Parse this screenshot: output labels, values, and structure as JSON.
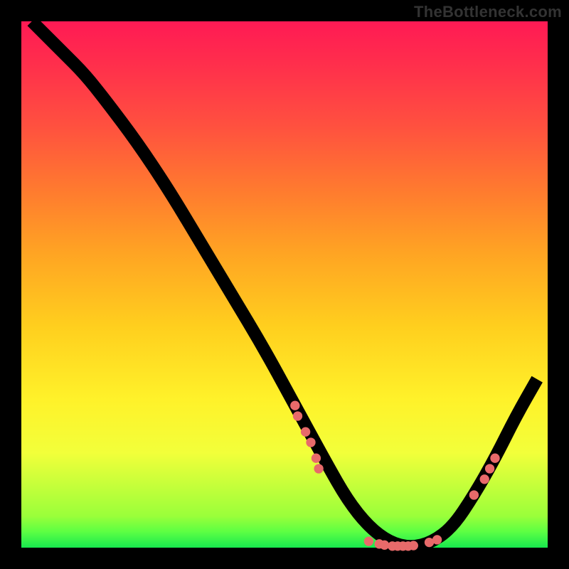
{
  "watermark": "TheBottleneck.com",
  "chart_data": {
    "type": "line",
    "title": "",
    "xlabel": "",
    "ylabel": "",
    "xlim": [
      0,
      100
    ],
    "ylim": [
      0,
      100
    ],
    "background": {
      "type": "vertical-gradient",
      "stops": [
        {
          "pos": 0,
          "color": "#ff1a54"
        },
        {
          "pos": 20,
          "color": "#ff513f"
        },
        {
          "pos": 44,
          "color": "#ffa423"
        },
        {
          "pos": 72,
          "color": "#fff22a"
        },
        {
          "pos": 100,
          "color": "#17e84e"
        }
      ]
    },
    "series": [
      {
        "name": "bottleneck-curve",
        "color": "#000000",
        "x": [
          2,
          5,
          8,
          12,
          16,
          22,
          28,
          34,
          40,
          46,
          52,
          58,
          62,
          66,
          70,
          74,
          78,
          82,
          86,
          90,
          94,
          98
        ],
        "y": [
          100,
          97,
          94,
          90,
          85,
          77,
          68,
          58,
          48,
          38,
          27,
          16,
          9,
          4,
          1,
          0,
          1,
          4,
          10,
          17,
          25,
          32
        ]
      }
    ],
    "markers": {
      "name": "highlight-points",
      "color": "#e86a6a",
      "points": [
        {
          "x": 52,
          "y": 27
        },
        {
          "x": 52.5,
          "y": 25
        },
        {
          "x": 54,
          "y": 22
        },
        {
          "x": 55,
          "y": 20
        },
        {
          "x": 56,
          "y": 17
        },
        {
          "x": 56.5,
          "y": 15
        },
        {
          "x": 66,
          "y": 1.2
        },
        {
          "x": 68,
          "y": 0.7
        },
        {
          "x": 69,
          "y": 0.5
        },
        {
          "x": 70.5,
          "y": 0.3
        },
        {
          "x": 71.5,
          "y": 0.3
        },
        {
          "x": 72.5,
          "y": 0.3
        },
        {
          "x": 73.5,
          "y": 0.3
        },
        {
          "x": 74.5,
          "y": 0.4
        },
        {
          "x": 77.5,
          "y": 1.0
        },
        {
          "x": 79,
          "y": 1.5
        },
        {
          "x": 86,
          "y": 10
        },
        {
          "x": 88,
          "y": 13
        },
        {
          "x": 89,
          "y": 15
        },
        {
          "x": 90,
          "y": 17
        }
      ]
    }
  }
}
